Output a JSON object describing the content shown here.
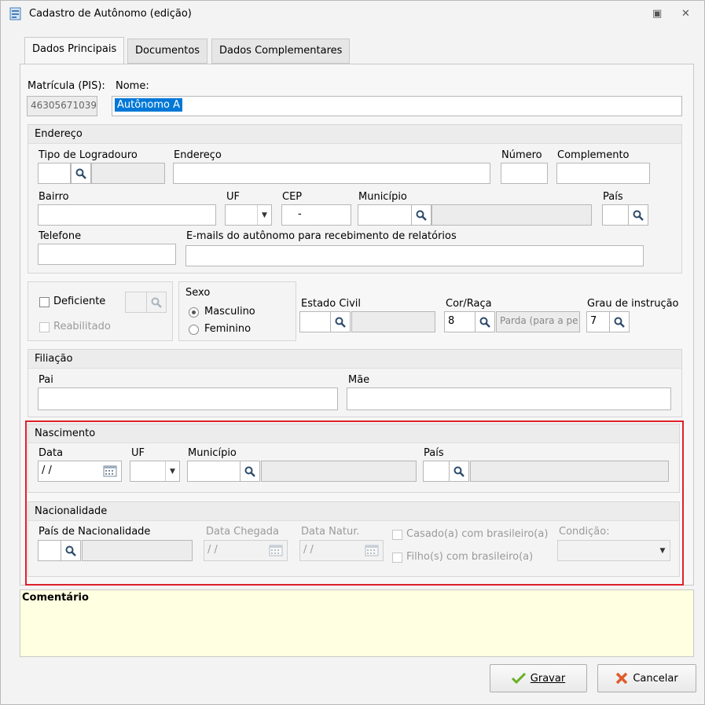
{
  "window": {
    "title": "Cadastro de Autônomo (edição)",
    "restore_glyph": "▣",
    "close_glyph": "✕"
  },
  "tabs": [
    {
      "label": "Dados Principais"
    },
    {
      "label": "Documentos"
    },
    {
      "label": "Dados Complementares"
    }
  ],
  "top": {
    "pis_label": "Matrícula (PIS):",
    "pis_value": "46305671039",
    "nome_label": "Nome:",
    "nome_value": "Autônomo A"
  },
  "endereco": {
    "title": "Endereço",
    "tipo_logradouro": "Tipo de Logradouro",
    "endereco": "Endereço",
    "numero": "Número",
    "complemento": "Complemento",
    "bairro": "Bairro",
    "uf": "UF",
    "cep": "CEP",
    "cep_value": "-",
    "municipio": "Município",
    "pais": "País",
    "telefone": "Telefone",
    "emails": "E-mails do autônomo para recebimento de relatórios"
  },
  "pessoal": {
    "deficiente": "Deficiente",
    "reabilitado": "Reabilitado",
    "sexo": "Sexo",
    "masculino": "Masculino",
    "feminino": "Feminino",
    "estado_civil": "Estado Civil",
    "cor_raca": "Cor/Raça",
    "cor_code": "8",
    "cor_desc": "Parda (para a pe",
    "grau": "Grau de instrução",
    "grau_code": "7"
  },
  "filiacao": {
    "title": "Filiação",
    "pai": "Pai",
    "mae": "Mãe"
  },
  "nascimento": {
    "title": "Nascimento",
    "data": "Data",
    "data_value": "/ /",
    "uf": "UF",
    "municipio": "Município",
    "pais": "País"
  },
  "nacionalidade": {
    "title": "Nacionalidade",
    "pais_nac": "País de Nacionalidade",
    "data_chegada": "Data Chegada",
    "data_chegada_value": "/ /",
    "data_natur": "Data Natur.",
    "data_natur_value": "/ /",
    "casado": "Casado(a) com brasileiro(a)",
    "filhos": "Filho(s) com brasileiro(a)",
    "condicao": "Condição:"
  },
  "comentario": {
    "label": "Comentário"
  },
  "buttons": {
    "gravar": "Gravar",
    "cancelar": "Cancelar"
  },
  "colors": {
    "accent_selection": "#0078d7",
    "highlight_border": "#e0202b",
    "comment_bg": "#ffffe1"
  }
}
